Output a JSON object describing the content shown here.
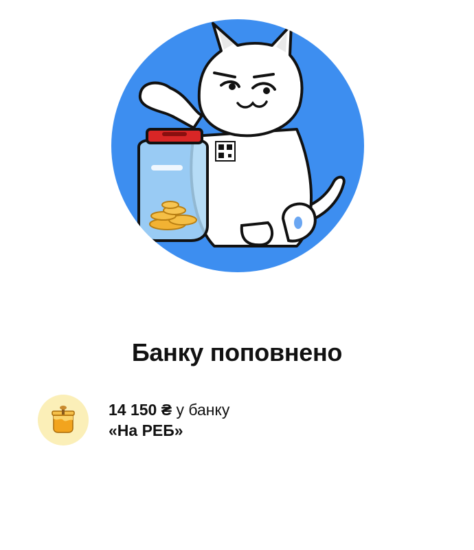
{
  "header": {
    "title": "Банку поповнено"
  },
  "deposit": {
    "amount": "14 150 ₴",
    "to_text": " у банку",
    "jar_name": "«На РЕБ»",
    "avatar_icon": "honey-jar-icon"
  },
  "illustration": {
    "subject": "cat-dropping-coin-into-jar",
    "circle_color": "#3d8ef0",
    "lid_color": "#d92626",
    "coin_color": "#f2b233"
  }
}
